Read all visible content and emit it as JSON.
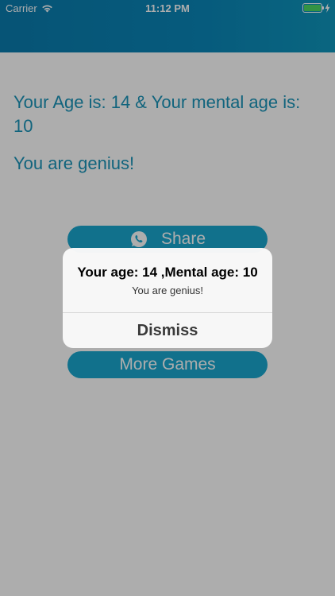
{
  "status_bar": {
    "carrier": "Carrier",
    "time": "11:12 PM"
  },
  "main": {
    "age_text": "Your Age is: 14 & Your mental age is: 10",
    "result_text": "You are genius!",
    "share_label": "Share",
    "more_games_label": "More Games"
  },
  "alert": {
    "title": "Your age: 14 ,Mental age: 10",
    "message": "You are genius!",
    "dismiss_label": "Dismiss"
  },
  "colors": {
    "header": "#0a86b8",
    "accent_text": "#1a94b8",
    "button": "#1aa7cf",
    "battery": "#4cd964"
  },
  "icons": {
    "wifi": "wifi-icon",
    "battery": "battery-icon",
    "charging": "charging-bolt-icon",
    "share": "whatsapp-icon"
  }
}
